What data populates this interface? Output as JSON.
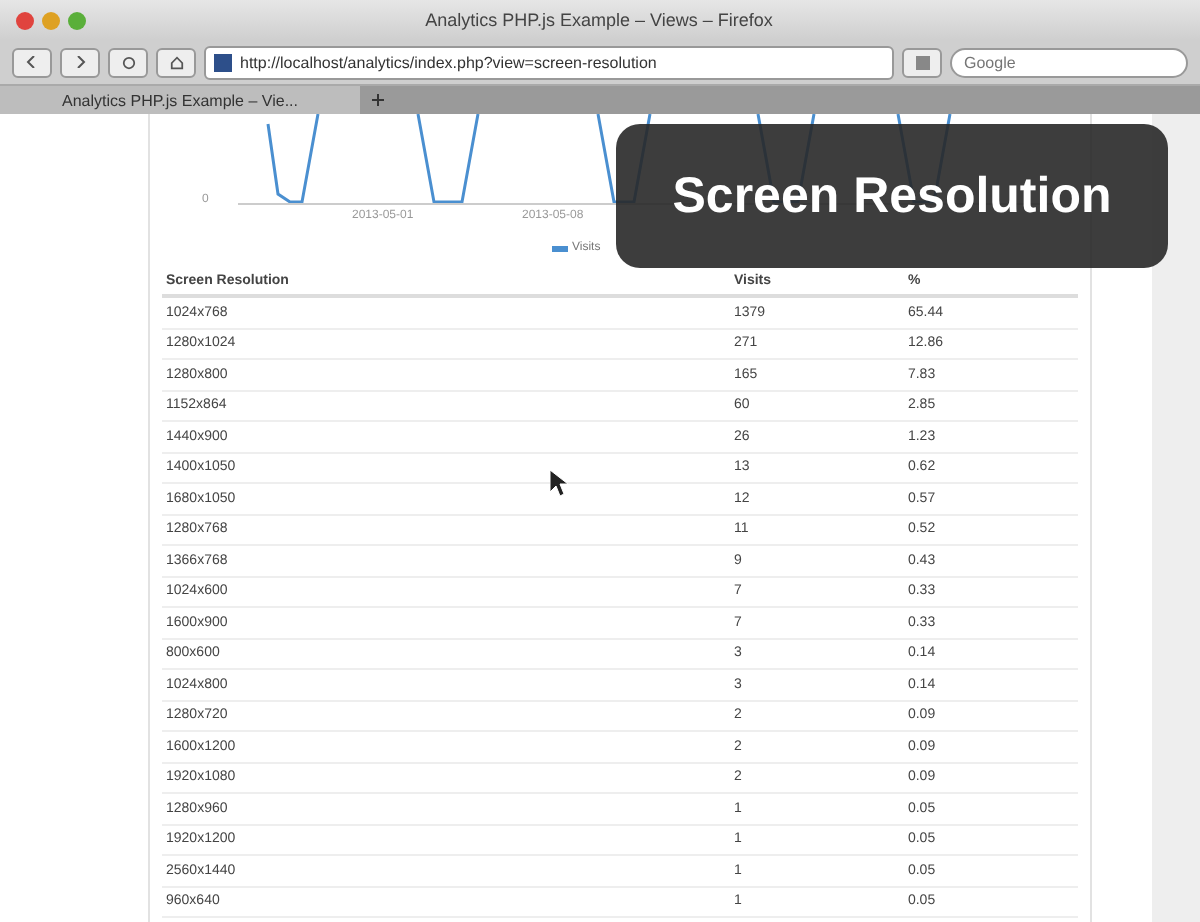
{
  "window": {
    "title": "Analytics PHP.js Example – Views – Firefox"
  },
  "toolbar": {
    "url": "http://localhost/analytics/index.php?view=screen-resolution",
    "search": {
      "placeholder": "Google"
    }
  },
  "tabs": [
    {
      "label": "Analytics PHP.js Example – Vie...",
      "selected": true
    }
  ],
  "chart": {
    "y_tick": "0",
    "x_labels": [
      "2013-05-01",
      "2013-05-08"
    ],
    "legend": "Visits"
  },
  "overlay": {
    "caption": "Screen Resolution"
  },
  "table": {
    "columns": [
      "Screen Resolution",
      "Visits",
      "%"
    ],
    "rows": [
      [
        "1024x768",
        "1379",
        "65.44"
      ],
      [
        "1280x1024",
        "271",
        "12.86"
      ],
      [
        "1280x800",
        "165",
        "7.83"
      ],
      [
        "1152x864",
        "60",
        "2.85"
      ],
      [
        "1440x900",
        "26",
        "1.23"
      ],
      [
        "1400x1050",
        "13",
        "0.62"
      ],
      [
        "1680x1050",
        "12",
        "0.57"
      ],
      [
        "1280x768",
        "11",
        "0.52"
      ],
      [
        "1366x768",
        "9",
        "0.43"
      ],
      [
        "1024x600",
        "7",
        "0.33"
      ],
      [
        "1600x900",
        "7",
        "0.33"
      ],
      [
        "800x600",
        "3",
        "0.14"
      ],
      [
        "1024x800",
        "3",
        "0.14"
      ],
      [
        "1280x720",
        "2",
        "0.09"
      ],
      [
        "1600x1200",
        "2",
        "0.09"
      ],
      [
        "1920x1080",
        "2",
        "0.09"
      ],
      [
        "1280x960",
        "1",
        "0.05"
      ],
      [
        "1920x1200",
        "1",
        "0.05"
      ],
      [
        "2560x1440",
        "1",
        "0.05"
      ],
      [
        "960x640",
        "1",
        "0.05"
      ]
    ]
  }
}
